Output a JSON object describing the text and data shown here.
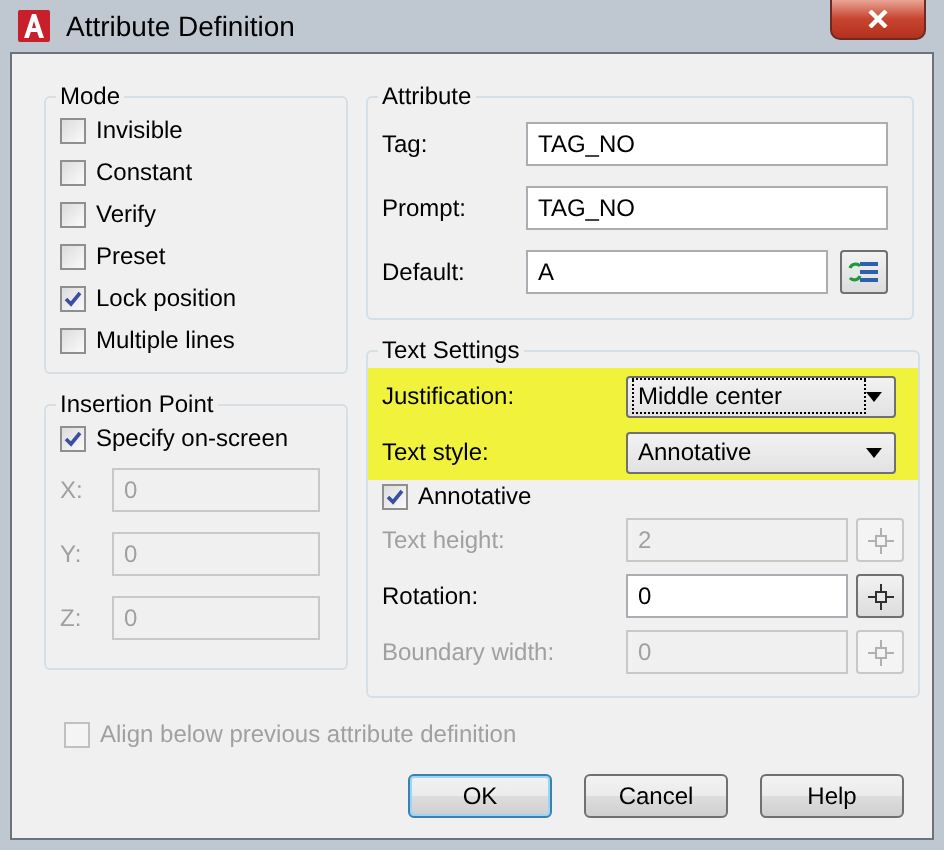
{
  "window": {
    "title": "Attribute Definition"
  },
  "mode": {
    "label": "Mode",
    "items": [
      {
        "label": "Invisible",
        "checked": false
      },
      {
        "label": "Constant",
        "checked": false
      },
      {
        "label": "Verify",
        "checked": false
      },
      {
        "label": "Preset",
        "checked": false
      },
      {
        "label": "Lock position",
        "checked": true
      },
      {
        "label": "Multiple lines",
        "checked": false
      }
    ]
  },
  "insertion_point": {
    "label": "Insertion Point",
    "specify": {
      "label": "Specify on-screen",
      "checked": true
    },
    "coords": [
      {
        "label": "X:",
        "value": "0",
        "disabled": true
      },
      {
        "label": "Y:",
        "value": "0",
        "disabled": true
      },
      {
        "label": "Z:",
        "value": "0",
        "disabled": true
      }
    ]
  },
  "attribute": {
    "label": "Attribute",
    "fields": [
      {
        "kind": "text",
        "label": "Tag:",
        "value": "TAG_NO"
      },
      {
        "kind": "text",
        "label": "Prompt:",
        "value": "TAG_NO"
      },
      {
        "kind": "field-button",
        "label": "Default:",
        "value": "A"
      }
    ]
  },
  "text_settings": {
    "label": "Text Settings",
    "rows": [
      {
        "kind": "dropdown",
        "label": "Justification:",
        "value": "Middle center",
        "highlighted": true,
        "focused": true
      },
      {
        "kind": "dropdown",
        "label": "Text style:",
        "value": "Annotative",
        "highlighted": true,
        "focused": false
      },
      {
        "kind": "checkbox",
        "label": "Annotative",
        "checked": true
      },
      {
        "kind": "pick",
        "label": "Text height:",
        "value": "2",
        "disabled": true
      },
      {
        "kind": "pick",
        "label": "Rotation:",
        "value": "0",
        "disabled": false
      },
      {
        "kind": "pick",
        "label": "Boundary width:",
        "value": "0",
        "disabled": true
      }
    ]
  },
  "align": {
    "label": "Align below previous attribute definition",
    "checked": false,
    "disabled": true
  },
  "buttons": [
    {
      "label": "OK",
      "default": true
    },
    {
      "label": "Cancel",
      "default": false
    },
    {
      "label": "Help",
      "default": false
    }
  ]
}
